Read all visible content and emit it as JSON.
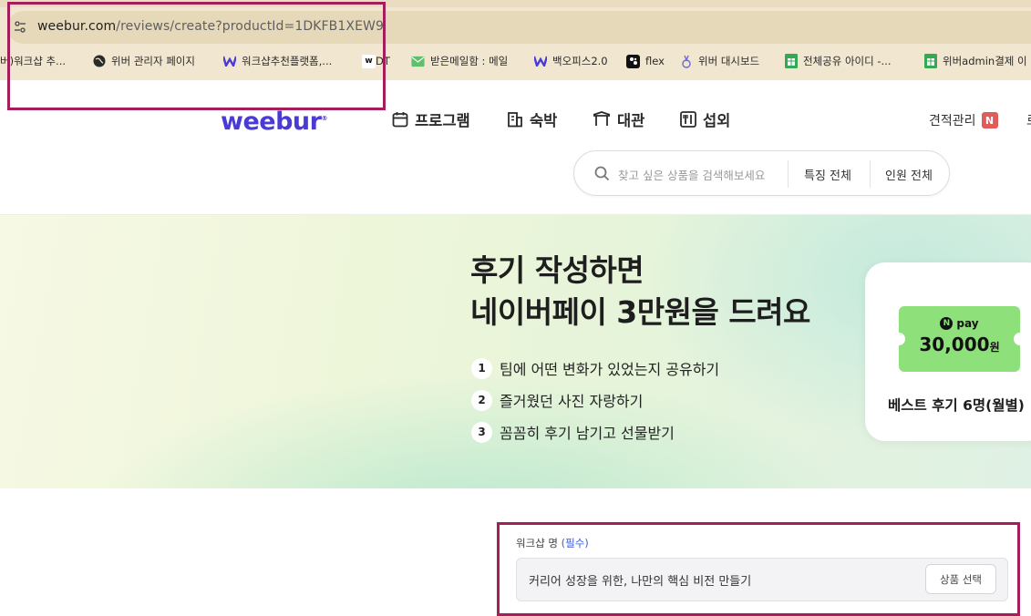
{
  "browser": {
    "url_host": "weebur.com",
    "url_path": "/reviews/create?productId=1DKFB1XEW9",
    "bookmarks": [
      {
        "label": "버)워크샵 추...",
        "icon": "none"
      },
      {
        "label": "위버 관리자 페이지",
        "icon": "globe-icon"
      },
      {
        "label": "워크샵추천플랫폼,...",
        "icon": "weebur-w-icon"
      },
      {
        "label": "DT",
        "icon": "w-square-icon"
      },
      {
        "label": "받은메일함 : 메일",
        "icon": "mail-icon"
      },
      {
        "label": "백오피스2.0",
        "icon": "weebur-w-icon"
      },
      {
        "label": "flex",
        "icon": "flex-icon"
      },
      {
        "label": "위버 대시보드",
        "icon": "dashboard-icon"
      },
      {
        "label": "전체공유 아이디 -...",
        "icon": "sheets-icon"
      },
      {
        "label": "위버admin결제 이",
        "icon": "sheets-icon"
      }
    ]
  },
  "site": {
    "logo_text": "weebur",
    "logo_mark": "®",
    "nav": [
      {
        "label": "프로그램",
        "icon": "calendar-icon"
      },
      {
        "label": "숙박",
        "icon": "building-icon"
      },
      {
        "label": "대관",
        "icon": "venue-icon"
      },
      {
        "label": "섭외",
        "icon": "dining-icon"
      }
    ],
    "estimate_label": "견적관리",
    "estimate_badge": "N",
    "cut_char": "로",
    "search": {
      "placeholder": "찾고 싶은 상품을 검색해보세요",
      "filter_feature": "특징 전체",
      "filter_people": "인원 전체"
    }
  },
  "banner": {
    "title_line1": "후기 작성하면",
    "title_line2": "네이버페이 3만원을 드려요",
    "steps": [
      {
        "num": "1",
        "text": "팀에 어떤 변화가 있었는지 공유하기"
      },
      {
        "num": "2",
        "text": "즐거웠던 사진 자랑하기"
      },
      {
        "num": "3",
        "text": "꼼꼼히 후기 남기고 선물받기"
      }
    ],
    "card": {
      "npay_label": "pay",
      "npay_mark": "N",
      "amount": "30,000",
      "currency": "원",
      "caption": "베스트 후기 6명(월별)"
    }
  },
  "form": {
    "label": "워크샵 명",
    "required": "(필수)",
    "value": "커리어 성장을 위한, 나만의 핵심 비전 만들기",
    "select_button": "상품 선택"
  },
  "colors": {
    "brand": "#4a3ad6",
    "highlight": "#a51e5c",
    "npay_green": "#8ee07a",
    "badge_red": "#e25b5b",
    "required_blue": "#3b5bd6"
  }
}
